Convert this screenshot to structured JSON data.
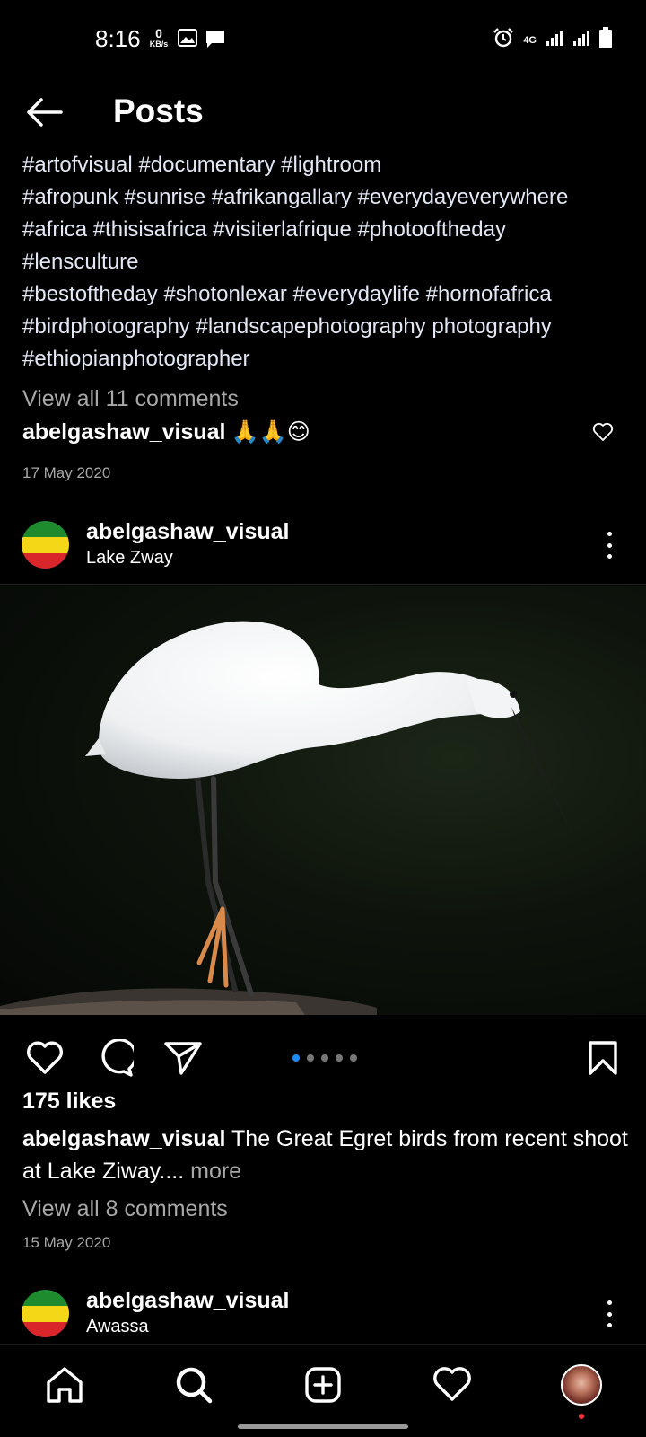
{
  "status_bar": {
    "time": "8:16",
    "net_speed_value": "0",
    "net_speed_unit": "KB/s",
    "network": "4G"
  },
  "header": {
    "title": "Posts"
  },
  "previous_post": {
    "caption_lines": [
      "#artofvisual #documentary  #lightroom",
      "#afropunk  #sunrise  #afrikangallary #everydayeverywhere",
      "#africa  #thisisafrica #visiterlafrique #photooftheday",
      "#lensculture",
      "#bestoftheday #shotonlexar #everydaylife #hornofafrica",
      "#birdphotography #landscapephotography photography",
      "#ethiopianphotographer"
    ],
    "view_comments": "View all 11 comments",
    "top_comment_user": "abelgashaw_visual",
    "top_comment_text": "🙏🙏😊",
    "date": "17 May 2020"
  },
  "post": {
    "username": "abelgashaw_visual",
    "location": "Lake Zway",
    "likes": "175 likes",
    "caption_user": "abelgashaw_visual",
    "caption_text": "The Great Egret birds from recent shoot at Lake Ziway....",
    "caption_more": "more",
    "view_comments": "View all 8 comments",
    "date": "15 May 2020",
    "carousel_total": 5,
    "carousel_active": 1
  },
  "next_post": {
    "username": "abelgashaw_visual",
    "location": "Awassa"
  },
  "nav": {
    "items": [
      "home-icon",
      "search-icon",
      "add-post-icon",
      "activity-heart-icon",
      "profile-avatar"
    ]
  },
  "colors": {
    "background": "#000000",
    "accent_blue": "#1d8cf8",
    "muted_text": "#a8a8a8",
    "notification_red": "#ff3040"
  }
}
